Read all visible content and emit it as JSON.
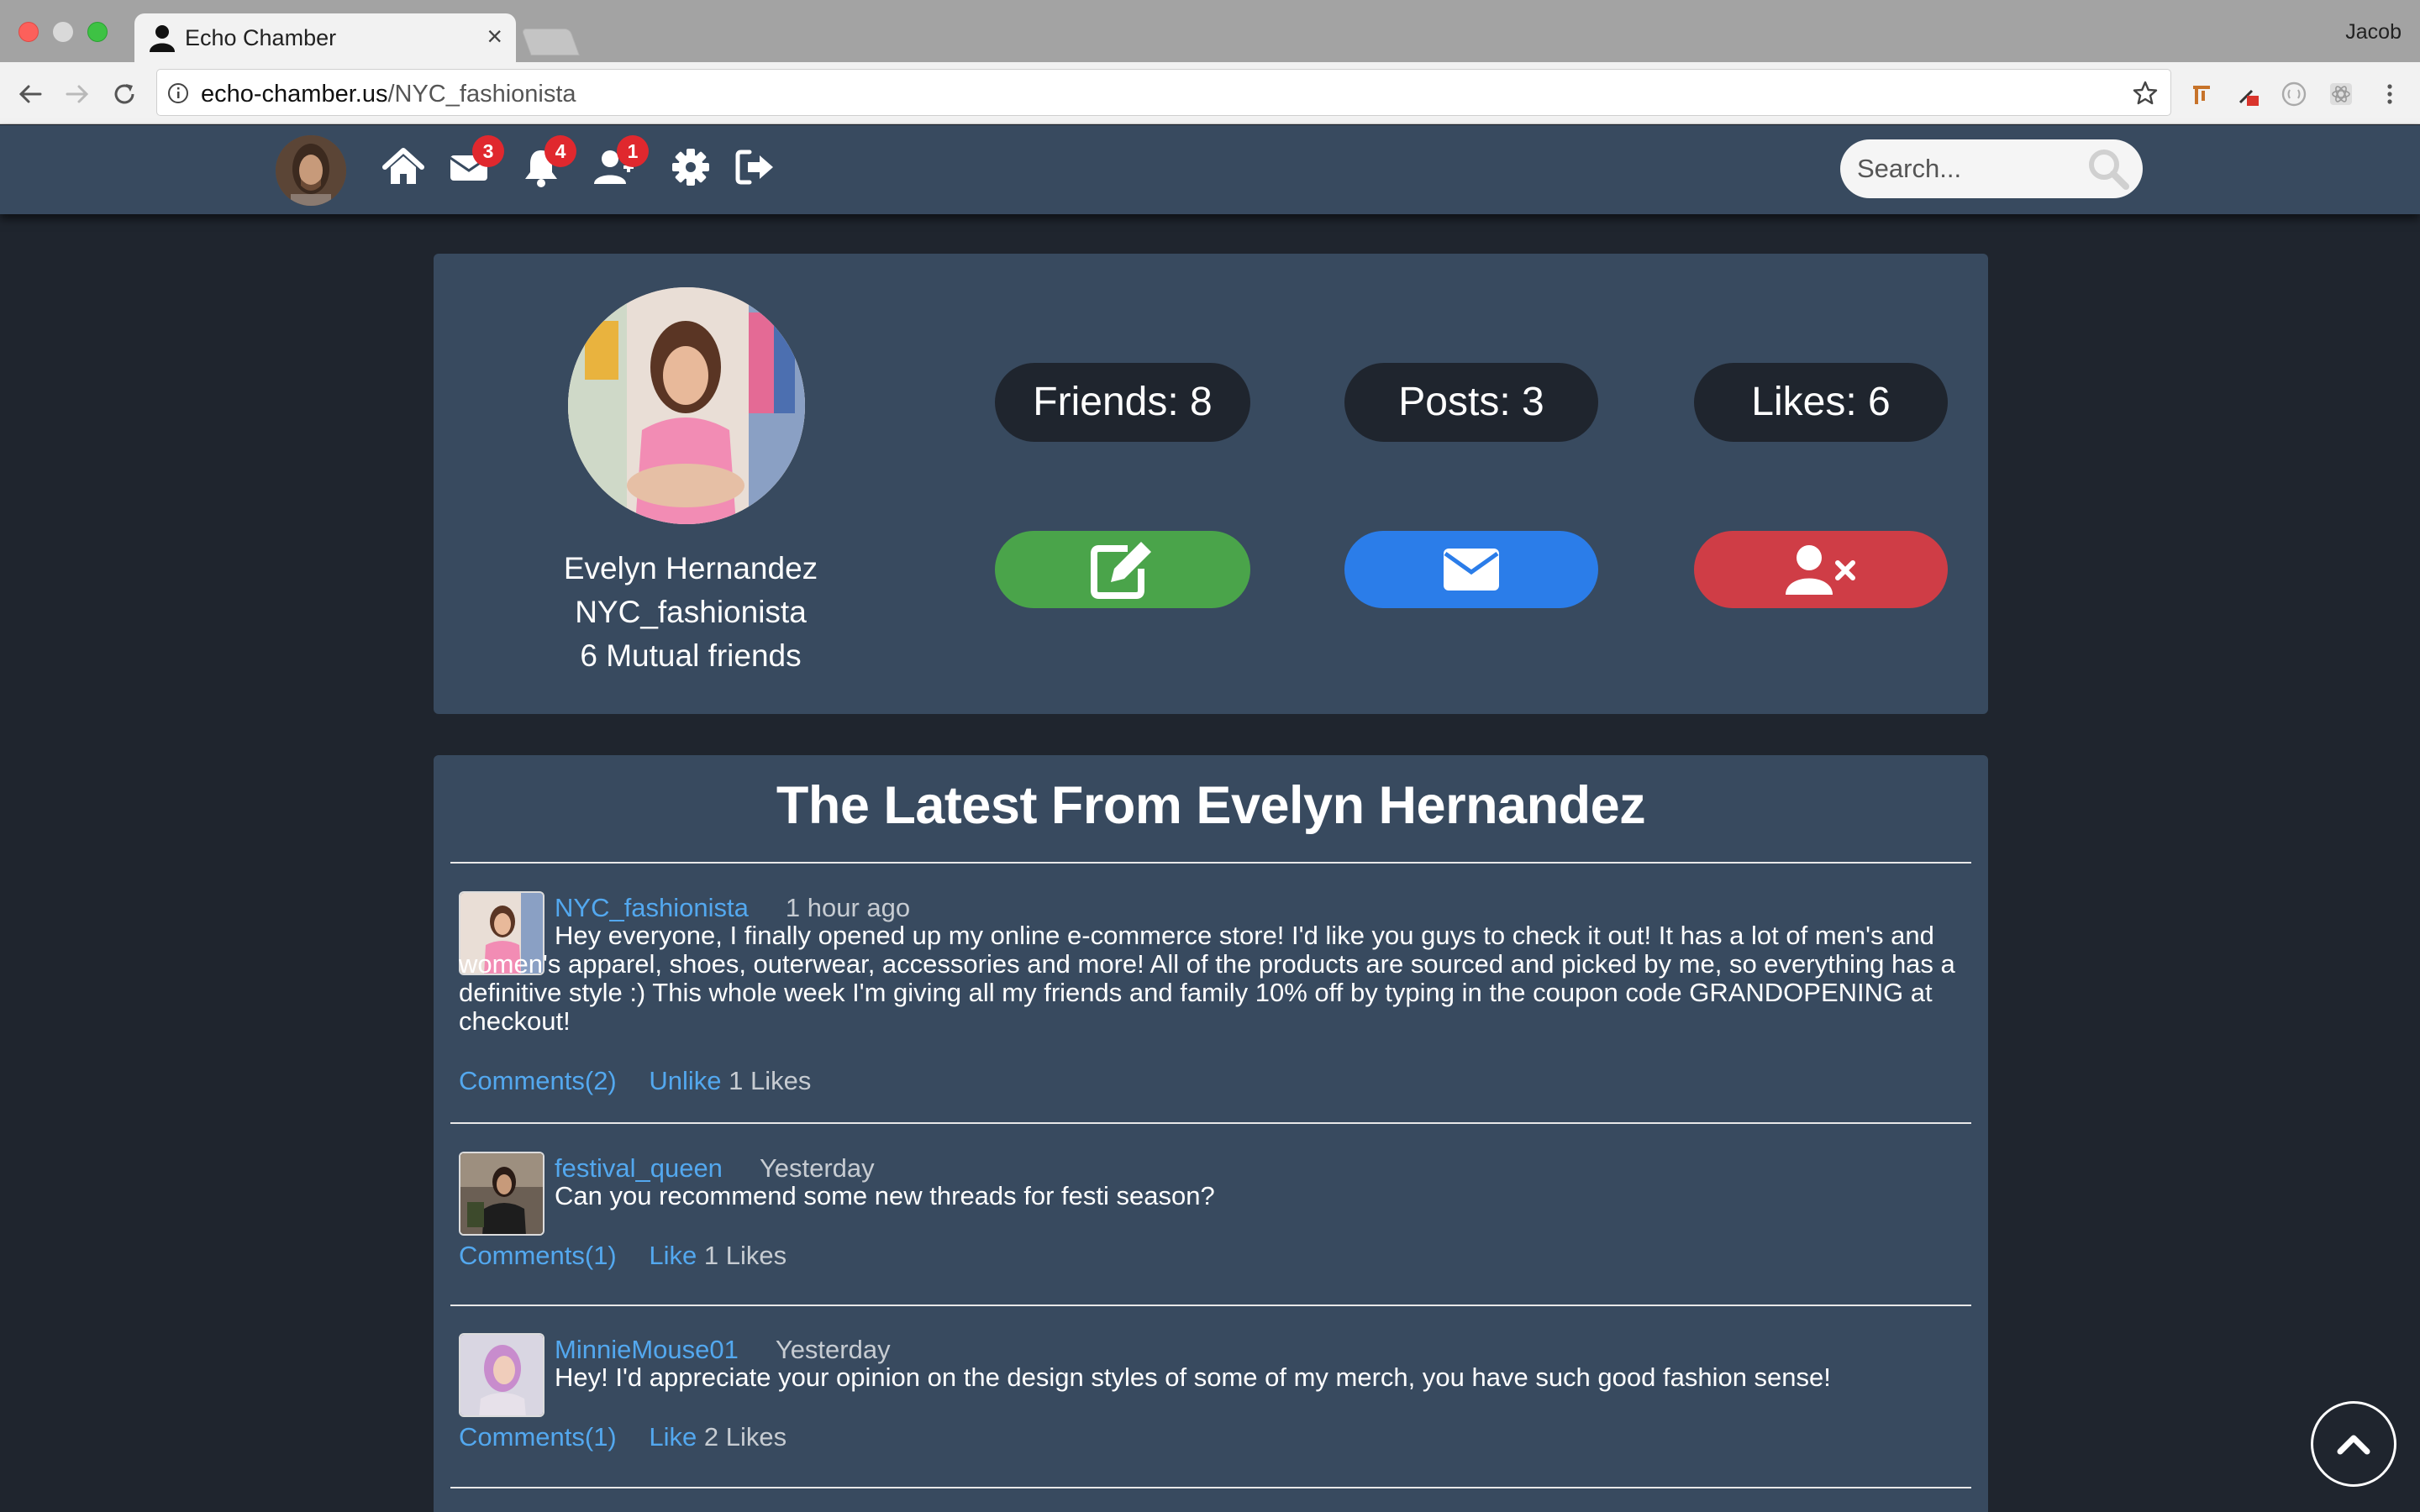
{
  "browser": {
    "tab_title": "Echo Chamber",
    "profile_name": "Jacob",
    "url_host": "echo-chamber.us",
    "url_path": "/NYC_fashionista",
    "icons": {
      "tab": "person-icon",
      "close": "close-icon",
      "back": "back-arrow-icon",
      "forward": "forward-arrow-icon",
      "reload": "reload-icon",
      "info": "info-icon",
      "bookmark": "star-icon",
      "menu": "kebab-menu-icon"
    }
  },
  "nav": {
    "icons": [
      "home-icon",
      "envelope-icon",
      "bell-icon",
      "friends-icon",
      "gear-icon",
      "logout-icon"
    ],
    "messages_badge": "3",
    "notifications_badge": "4",
    "friend_requests_badge": "1",
    "search_placeholder": "Search..."
  },
  "profile": {
    "full_name": "Evelyn Hernandez",
    "username": "NYC_fashionista",
    "mutual_friends": "6 Mutual friends",
    "stats": {
      "friends": "Friends: 8",
      "posts": "Posts: 3",
      "likes": "Likes: 6"
    },
    "actions": {
      "edit_icon": "edit-icon",
      "message_icon": "envelope-icon",
      "unfriend_icon": "remove-user-icon"
    }
  },
  "feed": {
    "title": "The Latest From Evelyn Hernandez",
    "posts": [
      {
        "user": "NYC_fashionista",
        "time": "1 hour ago",
        "text": "Hey everyone, I finally opened up my online e-commerce store! I'd like you guys to check it out! It has a lot of men's and women's apparel, shoes, outerwear, accessories and more! All of the products are sourced and picked by me, so everything has a definitive style :) This whole week I'm giving all my friends and family 10% off by typing in the coupon code GRANDOPENING at checkout!",
        "comments": "Comments(2)",
        "like_action": "Unlike",
        "likes": "1 Likes"
      },
      {
        "user": "festival_queen",
        "time": "Yesterday",
        "text": "Can you recommend some new threads for festi season?",
        "comments": "Comments(1)",
        "like_action": "Like",
        "likes": "1 Likes"
      },
      {
        "user": "MinnieMouse01",
        "time": "Yesterday",
        "text": "Hey! I'd appreciate your opinion on the design styles of some of my merch, you have such good fashion sense!",
        "comments": "Comments(1)",
        "like_action": "Like",
        "likes": "2 Likes"
      }
    ]
  },
  "colors": {
    "page_bg": "#1f252e",
    "panel_bg": "#384a5f",
    "link": "#53a8ef",
    "badge": "#e0282e",
    "edit_button": "#4aa44a",
    "message_button": "#2b7de9",
    "unfriend_button": "#cf3d46"
  }
}
